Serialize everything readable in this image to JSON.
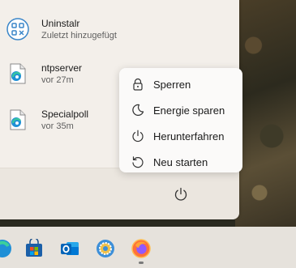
{
  "recent": [
    {
      "name": "Uninstalr",
      "sub": "Zuletzt hinzugefügt",
      "icon": "grid-app-icon"
    },
    {
      "name": "ntpserver",
      "sub": "vor 27m",
      "icon": "edge-document-icon"
    },
    {
      "name": "Specialpoll",
      "sub": "vor 35m",
      "icon": "edge-document-icon"
    }
  ],
  "power_menu": [
    {
      "label": "Sperren",
      "icon": "lock-icon"
    },
    {
      "label": "Energie sparen",
      "icon": "moon-icon"
    },
    {
      "label": "Herunterfahren",
      "icon": "power-icon"
    },
    {
      "label": "Neu starten",
      "icon": "restart-icon"
    }
  ],
  "taskbar": [
    {
      "icon": "edge-partial-icon"
    },
    {
      "icon": "microsoft-store-icon"
    },
    {
      "icon": "outlook-icon"
    },
    {
      "icon": "settings-gear-icon"
    },
    {
      "icon": "firefox-icon"
    }
  ],
  "colors": {
    "panel": "#f1ede8",
    "menu": "#fbfaf9",
    "taskbar": "#e6e2dc",
    "accent": "#0067c0"
  }
}
